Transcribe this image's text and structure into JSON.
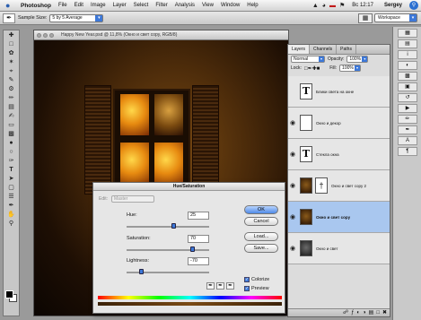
{
  "menubar": {
    "app": "Photoshop",
    "items": [
      "File",
      "Edit",
      "Image",
      "Layer",
      "Select",
      "Filter",
      "Analysis",
      "View",
      "Window",
      "Help"
    ],
    "clock": "Вс 12:17",
    "user": "Sergey"
  },
  "options": {
    "sample_label": "Sample Size:",
    "sample_value": "5 by 5 Average",
    "workspace": "Workspace"
  },
  "document": {
    "title": "Happy New Year.psd @ 11,8% (Окно и свет copy, RGB/8)"
  },
  "huesat": {
    "title": "Hue/Saturation",
    "edit_label": "Edit:",
    "edit_value": "Master",
    "hue_label": "Hue:",
    "hue_value": "25",
    "hue_frac": 0.57,
    "sat_label": "Saturation:",
    "sat_value": "70",
    "sat_frac": 0.82,
    "light_label": "Lightness:",
    "light_value": "-70",
    "light_frac": 0.16,
    "ok": "OK",
    "cancel": "Cancel",
    "load": "Load...",
    "save": "Save...",
    "colorize": "Colorize",
    "preview": "Preview"
  },
  "layers": {
    "tabs": [
      "Layers",
      "Channels",
      "Paths"
    ],
    "blend_mode": "Normal",
    "opacity_label": "Opacity:",
    "opacity": "100%",
    "lock_label": "Lock:",
    "fill_label": "Fill:",
    "fill": "100%",
    "items": [
      {
        "name": "Блики света на окне",
        "visible": false,
        "thumb": "text"
      },
      {
        "name": "Окно и декор",
        "visible": true,
        "thumb": "mask"
      },
      {
        "name": "Стекла окна",
        "visible": true,
        "thumb": "text"
      },
      {
        "name": "Окно и свет copy 2",
        "visible": true,
        "thumb": "img"
      },
      {
        "name": "Окно и свет copy",
        "visible": true,
        "thumb": "img",
        "selected": true
      },
      {
        "name": "Окно и свет",
        "visible": true,
        "thumb": "img-dark"
      }
    ]
  },
  "icons": {
    "apple": "apple-icon",
    "eye": "eye-icon"
  }
}
